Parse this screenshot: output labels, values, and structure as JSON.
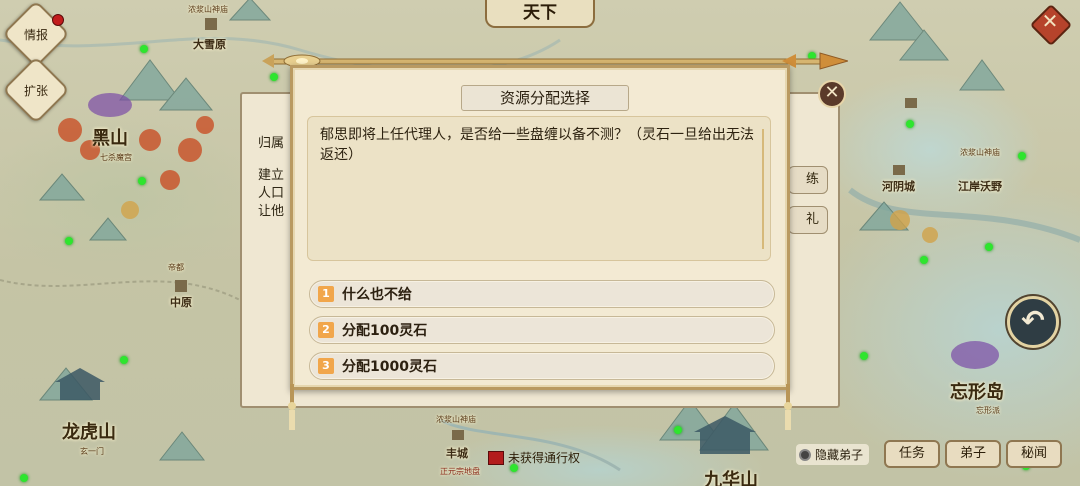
{
  "map": {
    "top_banner": "天下",
    "regions": [
      {
        "name": "黑山",
        "sub": "七杀魔宫"
      },
      {
        "name": "龙虎山",
        "sub": "玄一门"
      },
      {
        "name": "忘形岛",
        "sub": "忘形派"
      },
      {
        "name": "九华山",
        "sub": ""
      }
    ],
    "towns": [
      {
        "name": "大雪原",
        "tag": "浓浆山神庙"
      },
      {
        "name": "中原",
        "tag": "帝都"
      },
      {
        "name": "河阴城",
        "tag": ""
      },
      {
        "name": "江岸沃野",
        "tag": "浓浆山神庙"
      },
      {
        "name": "丰城",
        "tag": "浓浆山神庙"
      }
    ],
    "flag_label": "正元宗地盘",
    "notice": "未获得通行权"
  },
  "side_buttons": {
    "intel": "情报",
    "expand": "扩张"
  },
  "back_panel": {
    "label1": "归属",
    "label2": "建立",
    "label3": "人口",
    "label4": "让他",
    "pill1": "练",
    "pill2": "礼"
  },
  "dialog": {
    "title": "资源分配选择",
    "message": "郁思即将上任代理人，是否给一些盘缠以备不测？（灵石一旦给出无法返还）",
    "options": [
      {
        "num": "1",
        "label": "什么也不给"
      },
      {
        "num": "2",
        "label": "分配100灵石"
      },
      {
        "num": "3",
        "label": "分配1000灵石"
      }
    ]
  },
  "bottom_bar": {
    "hide_disciples": "隐藏弟子",
    "tasks": "任务",
    "disciples": "弟子",
    "secrets": "秘闻"
  },
  "colors": {
    "accent": "#f1a64b",
    "parchment": "#f3ead3",
    "frame": "#b99a62",
    "map_dot": "#2ee52e"
  }
}
